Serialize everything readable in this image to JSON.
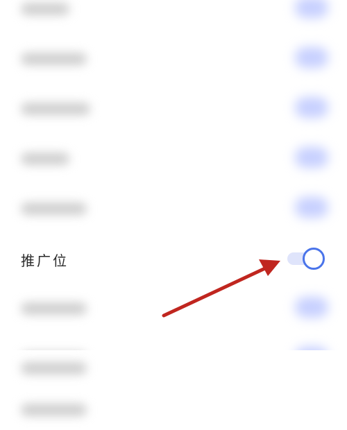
{
  "settings": {
    "visible_item": {
      "label": "推广位",
      "toggle_on": true
    }
  },
  "colors": {
    "toggle_accent": "#4a74ea",
    "toggle_track": "#dfe4fb",
    "arrow": "#c0261f",
    "blurred_toggle": "#c7d0ff"
  }
}
